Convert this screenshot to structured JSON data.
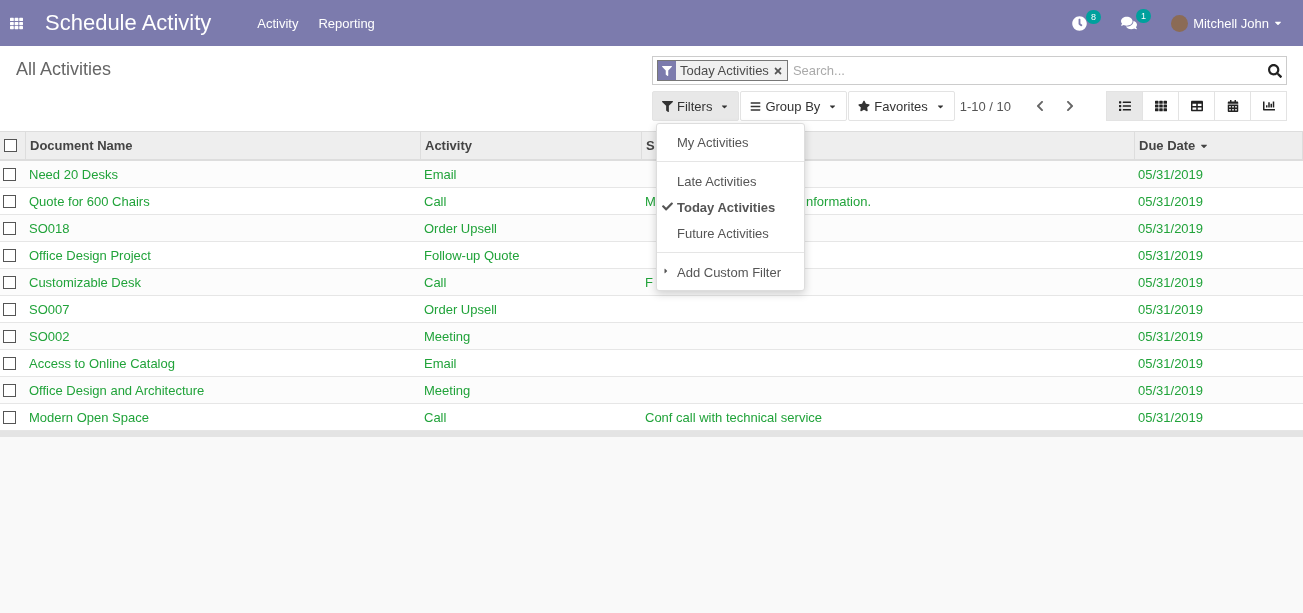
{
  "navbar": {
    "app_title": "Schedule Activity",
    "menu": [
      "Activity",
      "Reporting"
    ],
    "activity_count": "8",
    "message_count": "1",
    "user": "Mitchell John"
  },
  "control_panel": {
    "breadcrumb": "All Activities",
    "search": {
      "facet": "Today Activities",
      "placeholder": "Search..."
    },
    "buttons": [
      {
        "kind": "filter",
        "label": "Filters",
        "selected": true
      },
      {
        "kind": "group",
        "label": "Group By",
        "selected": false
      },
      {
        "kind": "star",
        "label": "Favorites",
        "selected": false
      }
    ],
    "pager": "1-10 / 10",
    "views": [
      {
        "kind": "list",
        "selected": true
      },
      {
        "kind": "kanban",
        "selected": false
      },
      {
        "kind": "pivot",
        "selected": false
      },
      {
        "kind": "calendar",
        "selected": false
      },
      {
        "kind": "graph",
        "selected": false
      }
    ]
  },
  "filter_menu": [
    {
      "kind": "item",
      "label": "My Activities",
      "checked": false
    },
    {
      "kind": "divider"
    },
    {
      "kind": "item",
      "label": "Late Activities",
      "checked": false
    },
    {
      "kind": "item",
      "label": "Today Activities",
      "checked": true
    },
    {
      "kind": "item",
      "label": "Future Activities",
      "checked": false
    },
    {
      "kind": "divider"
    },
    {
      "kind": "custom",
      "label": "Add Custom Filter",
      "checked": false
    }
  ],
  "table": {
    "select_all_checked": false,
    "columns": [
      "Document Name",
      "Activity",
      "S",
      "Due Date"
    ],
    "rows": [
      {
        "document": "Need 20 Desks",
        "activity": "Email",
        "summary": [],
        "due_date": "05/31/2019",
        "checked": false
      },
      {
        "document": "Quote for 600 Chairs",
        "activity": "Call",
        "summary": [
          "M",
          "nformation."
        ],
        "due_date": "05/31/2019",
        "checked": false
      },
      {
        "document": "SO018",
        "activity": "Order Upsell",
        "summary": [],
        "due_date": "05/31/2019",
        "checked": false
      },
      {
        "document": "Office Design Project",
        "activity": "Follow-up Quote",
        "summary": [],
        "due_date": "05/31/2019",
        "checked": false
      },
      {
        "document": "Customizable Desk",
        "activity": "Call",
        "summary": [
          "F"
        ],
        "due_date": "05/31/2019",
        "checked": false
      },
      {
        "document": "SO007",
        "activity": "Order Upsell",
        "summary": [],
        "due_date": "05/31/2019",
        "checked": false
      },
      {
        "document": "SO002",
        "activity": "Meeting",
        "summary": [],
        "due_date": "05/31/2019",
        "checked": false
      },
      {
        "document": "Access to Online Catalog",
        "activity": "Email",
        "summary": [],
        "due_date": "05/31/2019",
        "checked": false
      },
      {
        "document": "Office Design and Architecture",
        "activity": "Meeting",
        "summary": [],
        "due_date": "05/31/2019",
        "checked": false
      },
      {
        "document": "Modern Open Space",
        "activity": "Call",
        "summary": [
          "Conf call with technical service"
        ],
        "due_date": "05/31/2019",
        "checked": false
      }
    ]
  }
}
